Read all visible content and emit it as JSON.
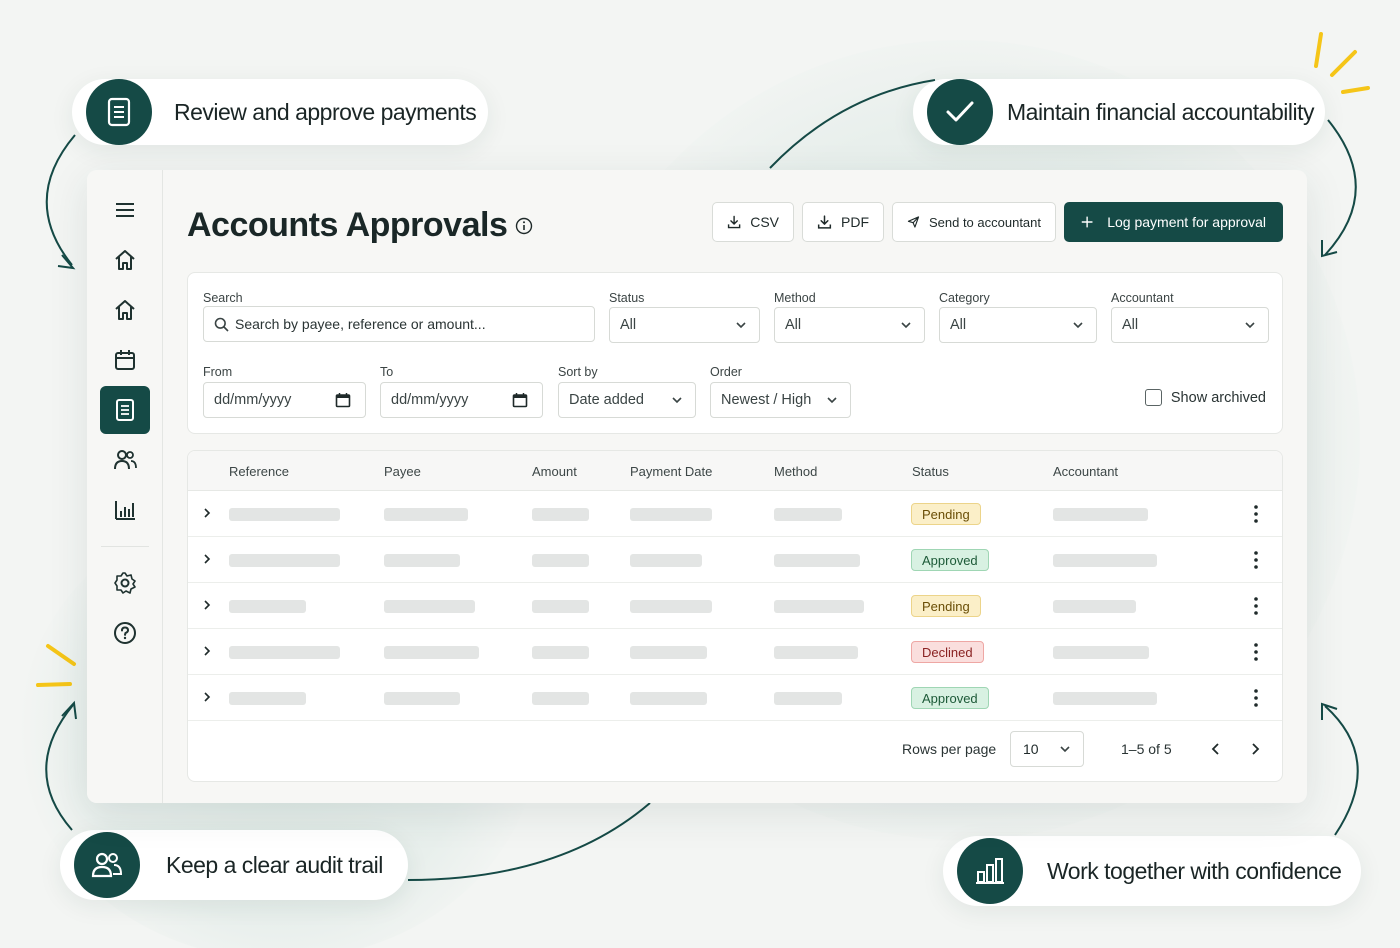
{
  "callouts": {
    "top_left": "Review and approve payments",
    "top_right": "Maintain financial accountability",
    "bottom_left": "Keep a clear audit trail",
    "bottom_right": "Work together with confidence"
  },
  "sidebar": {
    "items": [
      {
        "icon": "menu-icon"
      },
      {
        "icon": "home-icon"
      },
      {
        "icon": "home-icon"
      },
      {
        "icon": "calendar-icon"
      },
      {
        "icon": "document-icon",
        "active": true
      },
      {
        "icon": "users-icon"
      },
      {
        "icon": "bar-chart-icon"
      },
      {
        "icon": "gear-icon"
      },
      {
        "icon": "help-icon"
      }
    ]
  },
  "header": {
    "title": "Accounts Approvals",
    "csv_label": "CSV",
    "pdf_label": "PDF",
    "send_label": "Send to accountant",
    "log_label": "Log payment for approval"
  },
  "filters": {
    "search_label": "Search",
    "search_placeholder": "Search by payee, reference or amount...",
    "status_label": "Status",
    "status_value": "All",
    "method_label": "Method",
    "method_value": "All",
    "category_label": "Category",
    "category_value": "All",
    "accountant_label": "Accountant",
    "accountant_value": "All",
    "from_label": "From",
    "from_placeholder": "dd/mm/yyyy",
    "to_label": "To",
    "to_placeholder": "dd/mm/yyyy",
    "sortby_label": "Sort by",
    "sortby_value": "Date added",
    "order_label": "Order",
    "order_value": "Newest / High",
    "show_archived_label": "Show archived"
  },
  "table": {
    "columns": [
      "Reference",
      "Payee",
      "Amount",
      "Payment Date",
      "Method",
      "Status",
      "Accountant"
    ],
    "rows": [
      {
        "status": "Pending"
      },
      {
        "status": "Approved"
      },
      {
        "status": "Pending"
      },
      {
        "status": "Declined"
      },
      {
        "status": "Approved"
      }
    ]
  },
  "pagination": {
    "rows_per_page_label": "Rows per page",
    "rows_per_page_value": "10",
    "range_text": "1–5 of 5"
  },
  "colors": {
    "brand": "#154a46",
    "accent_spark": "#f5c518"
  }
}
